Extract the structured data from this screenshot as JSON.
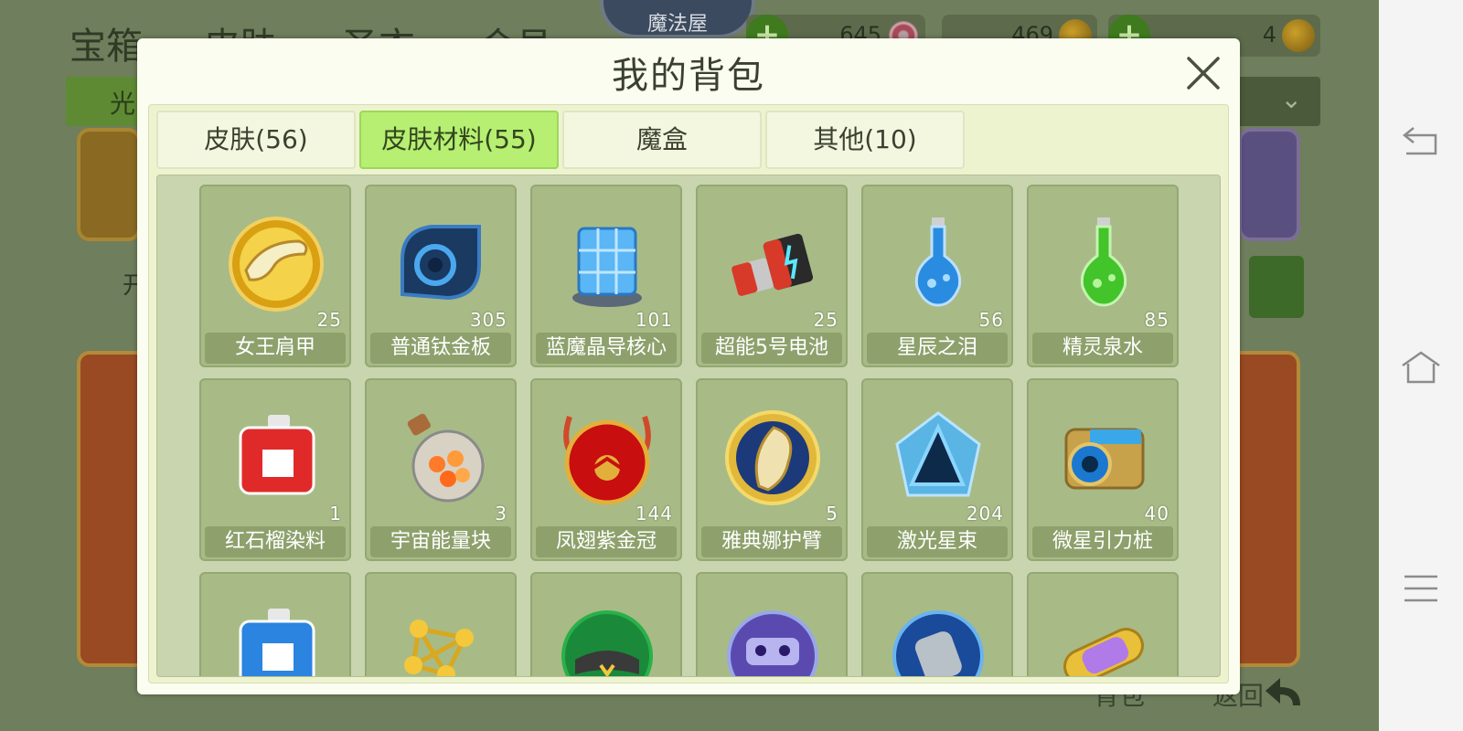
{
  "background": {
    "tabs": [
      "宝箱",
      "皮肤",
      "圣衣",
      "会员"
    ],
    "sign": "魔法屋",
    "currencies": [
      {
        "value": "645",
        "icon": "candy-swirl-icon"
      },
      {
        "value": "469",
        "icon": "gold-coin-icon"
      },
      {
        "value": "4",
        "icon": "gold-coin-icon"
      }
    ],
    "filter_label": "光",
    "side_text": "开",
    "bottom_bag": "背包",
    "bottom_back": "返回"
  },
  "modal": {
    "title": "我的背包",
    "tabs": [
      {
        "label": "皮肤(56)",
        "active": false
      },
      {
        "label": "皮肤材料(55)",
        "active": true
      },
      {
        "label": "魔盒",
        "active": false
      },
      {
        "label": "其他(10)",
        "active": false
      }
    ],
    "items": [
      {
        "name": "女王肩甲",
        "count": "25",
        "icon": "queen-shoulder-armor-icon"
      },
      {
        "name": "普通钛金板",
        "count": "305",
        "icon": "titanium-plate-icon"
      },
      {
        "name": "蓝魔晶导核心",
        "count": "101",
        "icon": "blue-crystal-core-icon"
      },
      {
        "name": "超能5号电池",
        "count": "25",
        "icon": "battery-icon"
      },
      {
        "name": "星辰之泪",
        "count": "56",
        "icon": "blue-flask-icon"
      },
      {
        "name": "精灵泉水",
        "count": "85",
        "icon": "green-flask-icon"
      },
      {
        "name": "红石榴染料",
        "count": "1",
        "icon": "red-dye-canister-icon"
      },
      {
        "name": "宇宙能量块",
        "count": "3",
        "icon": "energy-bottle-icon"
      },
      {
        "name": "凤翅紫金冠",
        "count": "144",
        "icon": "phoenix-crown-icon"
      },
      {
        "name": "雅典娜护臂",
        "count": "5",
        "icon": "athena-bracer-icon"
      },
      {
        "name": "激光星束",
        "count": "204",
        "icon": "laser-crystal-icon"
      },
      {
        "name": "微星引力桩",
        "count": "40",
        "icon": "gravity-device-icon"
      },
      {
        "name": "",
        "count": "",
        "icon": "blue-dye-canister-icon"
      },
      {
        "name": "",
        "count": "",
        "icon": "gold-molecule-icon"
      },
      {
        "name": "",
        "count": "",
        "icon": "green-helmet-icon"
      },
      {
        "name": "",
        "count": "",
        "icon": "purple-mask-icon"
      },
      {
        "name": "",
        "count": "",
        "icon": "robot-arm-icon"
      },
      {
        "name": "",
        "count": "",
        "icon": "purple-capsule-icon"
      }
    ]
  }
}
